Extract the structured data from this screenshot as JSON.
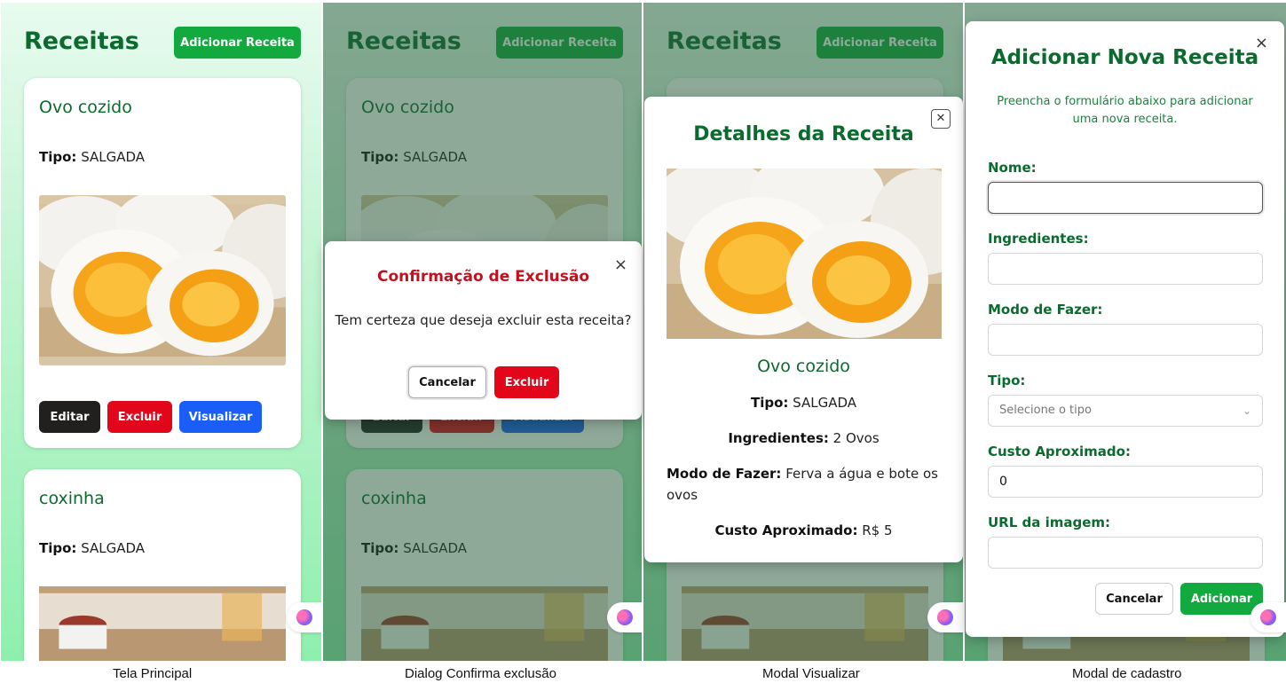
{
  "app": {
    "title": "Receitas",
    "add_button": "Adicionar Receita",
    "recipes": [
      {
        "name": "Ovo cozido",
        "type_label": "Tipo:",
        "type_value": "SALGADA",
        "actions": [
          "Editar",
          "Excluir",
          "Visualizar"
        ]
      },
      {
        "name": "coxinha",
        "type_label": "Tipo:",
        "type_value": "SALGADA"
      }
    ]
  },
  "confirm_dialog": {
    "title": "Confirmação de Exclusão",
    "message": "Tem certeza que deseja excluir esta receita?",
    "cancel": "Cancelar",
    "confirm": "Excluir",
    "close": "×"
  },
  "details_modal": {
    "title": "Detalhes da Receita",
    "close": "✕",
    "name": "Ovo cozido",
    "type_label": "Tipo:",
    "type_value": "SALGADA",
    "ingredients_label": "Ingredientes:",
    "ingredients_value": "2 Ovos",
    "method_label": "Modo de Fazer:",
    "method_value": "Ferva a água e bote os ovos",
    "cost_label": "Custo Aproximado:",
    "cost_value": "R$ 5"
  },
  "create_modal": {
    "title": "Adicionar Nova Receita",
    "close": "×",
    "description": "Preencha o formulário abaixo para adicionar uma nova receita.",
    "labels": {
      "name": "Nome:",
      "ingredients": "Ingredientes:",
      "method": "Modo de Fazer:",
      "type": "Tipo:",
      "cost": "Custo Aproximado:",
      "image_url": "URL da imagem:"
    },
    "values": {
      "name": "",
      "ingredients": "",
      "method": "",
      "cost": "0",
      "image_url": ""
    },
    "type_placeholder": "Selecione o tipo",
    "cancel": "Cancelar",
    "submit": "Adicionar"
  },
  "captions": [
    "Tela Principal",
    "Dialog Confirma exclusão",
    "Modal Visualizar",
    "Modal de cadastro"
  ],
  "colors": {
    "primary_green": "#0b6a2e",
    "button_green": "#12a93e",
    "danger_red": "#e3051a",
    "view_blue": "#1a5ef7",
    "edit_dark": "#221f1f"
  },
  "icons": [
    "brain-icon",
    "close-icon",
    "chevron-down-icon"
  ]
}
